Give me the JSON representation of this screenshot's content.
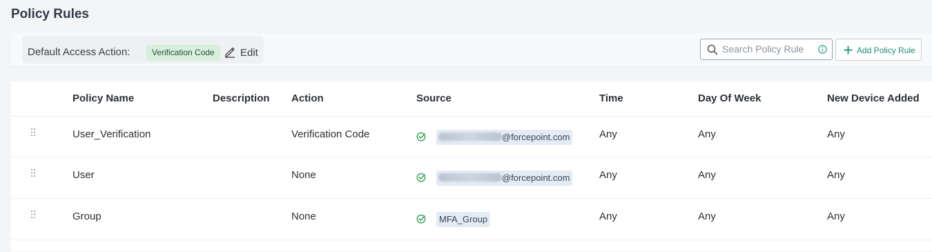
{
  "page": {
    "title": "Policy Rules"
  },
  "toolbar": {
    "default_access_label": "Default Access Action:",
    "default_access_value": "Verification Code",
    "edit_label": "Edit",
    "search_placeholder": "Search Policy Rule",
    "add_button_label": "Add Policy Rule",
    "accent_color": "#1f8a7a"
  },
  "table": {
    "columns": [
      "Policy Name",
      "Description",
      "Action",
      "Source",
      "Time",
      "Day Of Week",
      "New Device Added"
    ],
    "rows": [
      {
        "name": "User_Verification",
        "description": "",
        "action": "Verification Code",
        "source": "@forcepoint.com",
        "source_redacted": true,
        "time": "Any",
        "day_of_week": "Any",
        "new_device": "Any"
      },
      {
        "name": "User",
        "description": "",
        "action": "None",
        "source": "@forcepoint.com",
        "source_redacted": true,
        "time": "Any",
        "day_of_week": "Any",
        "new_device": "Any"
      },
      {
        "name": "Group",
        "description": "",
        "action": "None",
        "source": "MFA_Group",
        "source_redacted": false,
        "time": "Any",
        "day_of_week": "Any",
        "new_device": "Any"
      }
    ]
  },
  "icons": {
    "edit": "pencil-icon",
    "search": "search-icon",
    "info": "info-icon",
    "add": "plus-icon",
    "drag": "drag-handle-icon",
    "status": "check-circle-icon"
  },
  "colors": {
    "chip_green_bg": "#d6f0dc",
    "source_chip_bg": "#e3ebf4",
    "check_green": "#2e9e4f"
  }
}
